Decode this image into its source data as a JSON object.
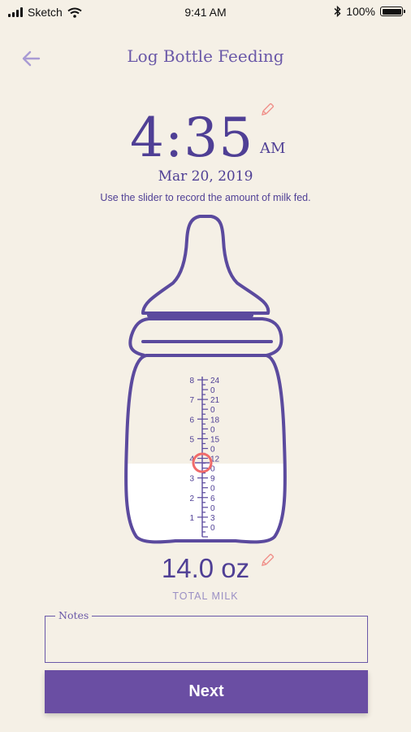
{
  "status_bar": {
    "carrier": "Sketch",
    "time": "9:41 AM",
    "battery": "100%"
  },
  "header": {
    "title": "Log Bottle Feeding",
    "back_icon": "arrow-left-icon"
  },
  "feeding": {
    "time": "4:35",
    "ampm": "AM",
    "date": "Mar 20, 2019",
    "instruction": "Use the slider to record the amount of milk fed.",
    "amount": "14.0 oz",
    "amount_label": "TOTAL MILK"
  },
  "scale": {
    "left_labels": [
      "8",
      "7",
      "6",
      "5",
      "4",
      "3",
      "2",
      "1"
    ],
    "right_labels": [
      "24",
      "0",
      "21",
      "0",
      "18",
      "0",
      "15",
      "0",
      "12",
      "0",
      "9",
      "0",
      "6",
      "0",
      "3",
      "0"
    ],
    "fill_level_oz": 14.0,
    "max_oz": 24
  },
  "notes": {
    "label": "Notes",
    "value": ""
  },
  "actions": {
    "next_label": "Next"
  },
  "colors": {
    "primary": "#6a4ea3",
    "text": "#4f3f95",
    "background": "#f5f0e6",
    "milk": "#ffffff",
    "slider_handle": "#f06a6a"
  }
}
